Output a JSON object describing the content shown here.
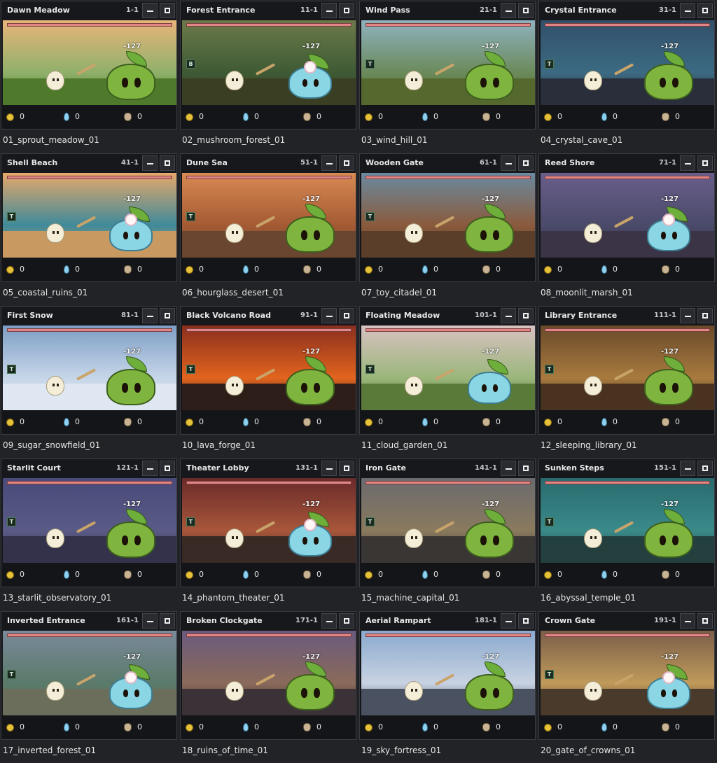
{
  "window_controls": {
    "minimize_icon": "minimize-icon",
    "maximize_icon": "maximize-icon"
  },
  "resource_icons": [
    "coin-icon",
    "crystal-icon",
    "material-bag-icon"
  ],
  "levels": [
    {
      "title": "Dawn Meadow",
      "stage": "1-1",
      "badge": "",
      "slime": "green",
      "flower": false,
      "gold": "0",
      "crystal": "0",
      "material": "0",
      "caption": "01_sprout_meadow_01",
      "sky": "#e8b57a",
      "horizon": "#8fb06a",
      "ground": "#4f7a2c"
    },
    {
      "title": "Forest Entrance",
      "stage": "11-1",
      "badge": "B",
      "slime": "blue",
      "flower": true,
      "gold": "0",
      "crystal": "0",
      "material": "0",
      "caption": "02_mushroom_forest_01",
      "sky": "#6c7a4a",
      "horizon": "#3e5a34",
      "ground": "#3a3e22"
    },
    {
      "title": "Wind Pass",
      "stage": "21-1",
      "badge": "T",
      "slime": "green",
      "flower": false,
      "gold": "0",
      "crystal": "0",
      "material": "0",
      "caption": "03_wind_hill_01",
      "sky": "#8fb2c0",
      "horizon": "#6b8a5a",
      "ground": "#55682e"
    },
    {
      "title": "Crystal Entrance",
      "stage": "31-1",
      "badge": "T",
      "slime": "green",
      "flower": false,
      "gold": "0",
      "crystal": "0",
      "material": "0",
      "caption": "04_crystal_cave_01",
      "sky": "#33506a",
      "horizon": "#3b6a82",
      "ground": "#2a2e3a"
    },
    {
      "title": "Shell Beach",
      "stage": "41-1",
      "badge": "T",
      "slime": "blue",
      "flower": true,
      "gold": "0",
      "crystal": "0",
      "material": "0",
      "caption": "05_coastal_ruins_01",
      "sky": "#e7a86a",
      "horizon": "#3f8a9a",
      "ground": "#c89a62"
    },
    {
      "title": "Dune Sea",
      "stage": "51-1",
      "badge": "T",
      "slime": "green",
      "flower": false,
      "gold": "0",
      "crystal": "0",
      "material": "0",
      "caption": "06_hourglass_desert_01",
      "sky": "#d88a52",
      "horizon": "#a45a34",
      "ground": "#6a4630"
    },
    {
      "title": "Wooden Gate",
      "stage": "61-1",
      "badge": "T",
      "slime": "green",
      "flower": false,
      "gold": "0",
      "crystal": "0",
      "material": "0",
      "caption": "07_toy_citadel_01",
      "sky": "#6a8aa0",
      "horizon": "#8a5a3c",
      "ground": "#5a3e2a"
    },
    {
      "title": "Reed Shore",
      "stage": "71-1",
      "badge": "",
      "slime": "blue",
      "flower": true,
      "gold": "0",
      "crystal": "0",
      "material": "0",
      "caption": "08_moonlit_marsh_01",
      "sky": "#6a5e8a",
      "horizon": "#4a4a6a",
      "ground": "#3a3446"
    },
    {
      "title": "First Snow",
      "stage": "81-1",
      "badge": "T",
      "slime": "green",
      "flower": false,
      "gold": "0",
      "crystal": "0",
      "material": "0",
      "caption": "09_sugar_snowfield_01",
      "sky": "#7e9ec6",
      "horizon": "#c6d6e8",
      "ground": "#dfe8f2"
    },
    {
      "title": "Black Volcano Road",
      "stage": "91-1",
      "badge": "T",
      "slime": "green",
      "flower": false,
      "gold": "0",
      "crystal": "0",
      "material": "0",
      "caption": "10_lava_forge_01",
      "sky": "#8a2e1e",
      "horizon": "#e2641e",
      "ground": "#2e1e1a"
    },
    {
      "title": "Floating Meadow",
      "stage": "101-1",
      "badge": "T",
      "slime": "blue",
      "flower": false,
      "gold": "0",
      "crystal": "0",
      "material": "0",
      "caption": "11_cloud_garden_01",
      "sky": "#d8c2c2",
      "horizon": "#9ab67a",
      "ground": "#5a7a3a"
    },
    {
      "title": "Library Entrance",
      "stage": "111-1",
      "badge": "T",
      "slime": "green",
      "flower": false,
      "gold": "0",
      "crystal": "0",
      "material": "0",
      "caption": "12_sleeping_library_01",
      "sky": "#6a4a2a",
      "horizon": "#a87a3e",
      "ground": "#4a3220"
    },
    {
      "title": "Starlit Court",
      "stage": "121-1",
      "badge": "T",
      "slime": "green",
      "flower": false,
      "gold": "0",
      "crystal": "0",
      "material": "0",
      "caption": "13_starlit_observatory_01",
      "sky": "#4a4a7a",
      "horizon": "#5a5a86",
      "ground": "#33324a"
    },
    {
      "title": "Theater Lobby",
      "stage": "131-1",
      "badge": "T",
      "slime": "blue",
      "flower": true,
      "gold": "0",
      "crystal": "0",
      "material": "0",
      "caption": "14_phantom_theater_01",
      "sky": "#6a2a2a",
      "horizon": "#a8563a",
      "ground": "#3a2a26"
    },
    {
      "title": "Iron Gate",
      "stage": "141-1",
      "badge": "T",
      "slime": "green",
      "flower": false,
      "gold": "0",
      "crystal": "0",
      "material": "0",
      "caption": "15_machine_capital_01",
      "sky": "#6a6a6e",
      "horizon": "#8a7a5e",
      "ground": "#3a3634"
    },
    {
      "title": "Sunken Steps",
      "stage": "151-1",
      "badge": "T",
      "slime": "green",
      "flower": false,
      "gold": "0",
      "crystal": "0",
      "material": "0",
      "caption": "16_abyssal_temple_01",
      "sky": "#2a6a6e",
      "horizon": "#3a8a8a",
      "ground": "#24403e"
    },
    {
      "title": "Inverted Entrance",
      "stage": "161-1",
      "badge": "T",
      "slime": "blue",
      "flower": true,
      "gold": "0",
      "crystal": "0",
      "material": "0",
      "caption": "17_inverted_forest_01",
      "sky": "#7a8a9a",
      "horizon": "#5a7a6a",
      "ground": "#6a6e5a"
    },
    {
      "title": "Broken Clockgate",
      "stage": "171-1",
      "badge": "",
      "slime": "green",
      "flower": false,
      "gold": "0",
      "crystal": "0",
      "material": "0",
      "caption": "18_ruins_of_time_01",
      "sky": "#6a5a7e",
      "horizon": "#8a6a5a",
      "ground": "#3a3236"
    },
    {
      "title": "Aerial Rampart",
      "stage": "181-1",
      "badge": "",
      "slime": "green",
      "flower": false,
      "gold": "0",
      "crystal": "0",
      "material": "0",
      "caption": "19_sky_fortress_01",
      "sky": "#8aaace",
      "horizon": "#c8d2e2",
      "ground": "#4a5262"
    },
    {
      "title": "Crown Gate",
      "stage": "191-1",
      "badge": "T",
      "slime": "blue",
      "flower": true,
      "gold": "0",
      "crystal": "0",
      "material": "0",
      "caption": "20_gate_of_crowns_01",
      "sky": "#7a5e4a",
      "horizon": "#c09a5a",
      "ground": "#4a3a2c"
    }
  ],
  "damage_text": "-127"
}
